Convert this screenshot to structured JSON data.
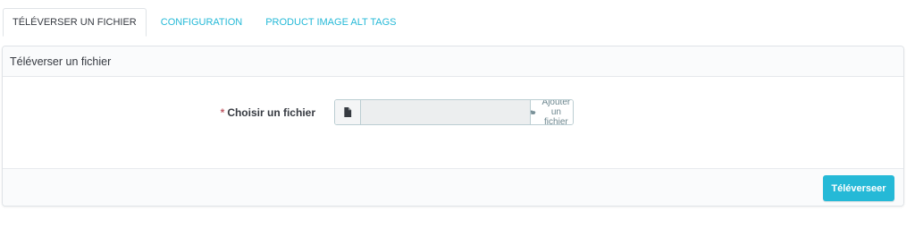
{
  "tabs": [
    {
      "label": "TÉLÉVERSER UN FICHIER",
      "active": true
    },
    {
      "label": "CONFIGURATION",
      "active": false
    },
    {
      "label": "PRODUCT IMAGE ALT TAGS",
      "active": false
    }
  ],
  "panel": {
    "heading": "Téléverser un fichier",
    "form": {
      "required_marker": "*",
      "file_label": "Choisir un fichier",
      "file_value": "",
      "file_icon": "file-icon",
      "add_icon": "folder-open-icon",
      "add_file_label": "Ajouter un fichier"
    },
    "submit_label": "Téléverseer"
  },
  "colors": {
    "accent": "#25b9d7",
    "text": "#363a41",
    "required": "#c05c67",
    "border": "#dfe3e7"
  }
}
